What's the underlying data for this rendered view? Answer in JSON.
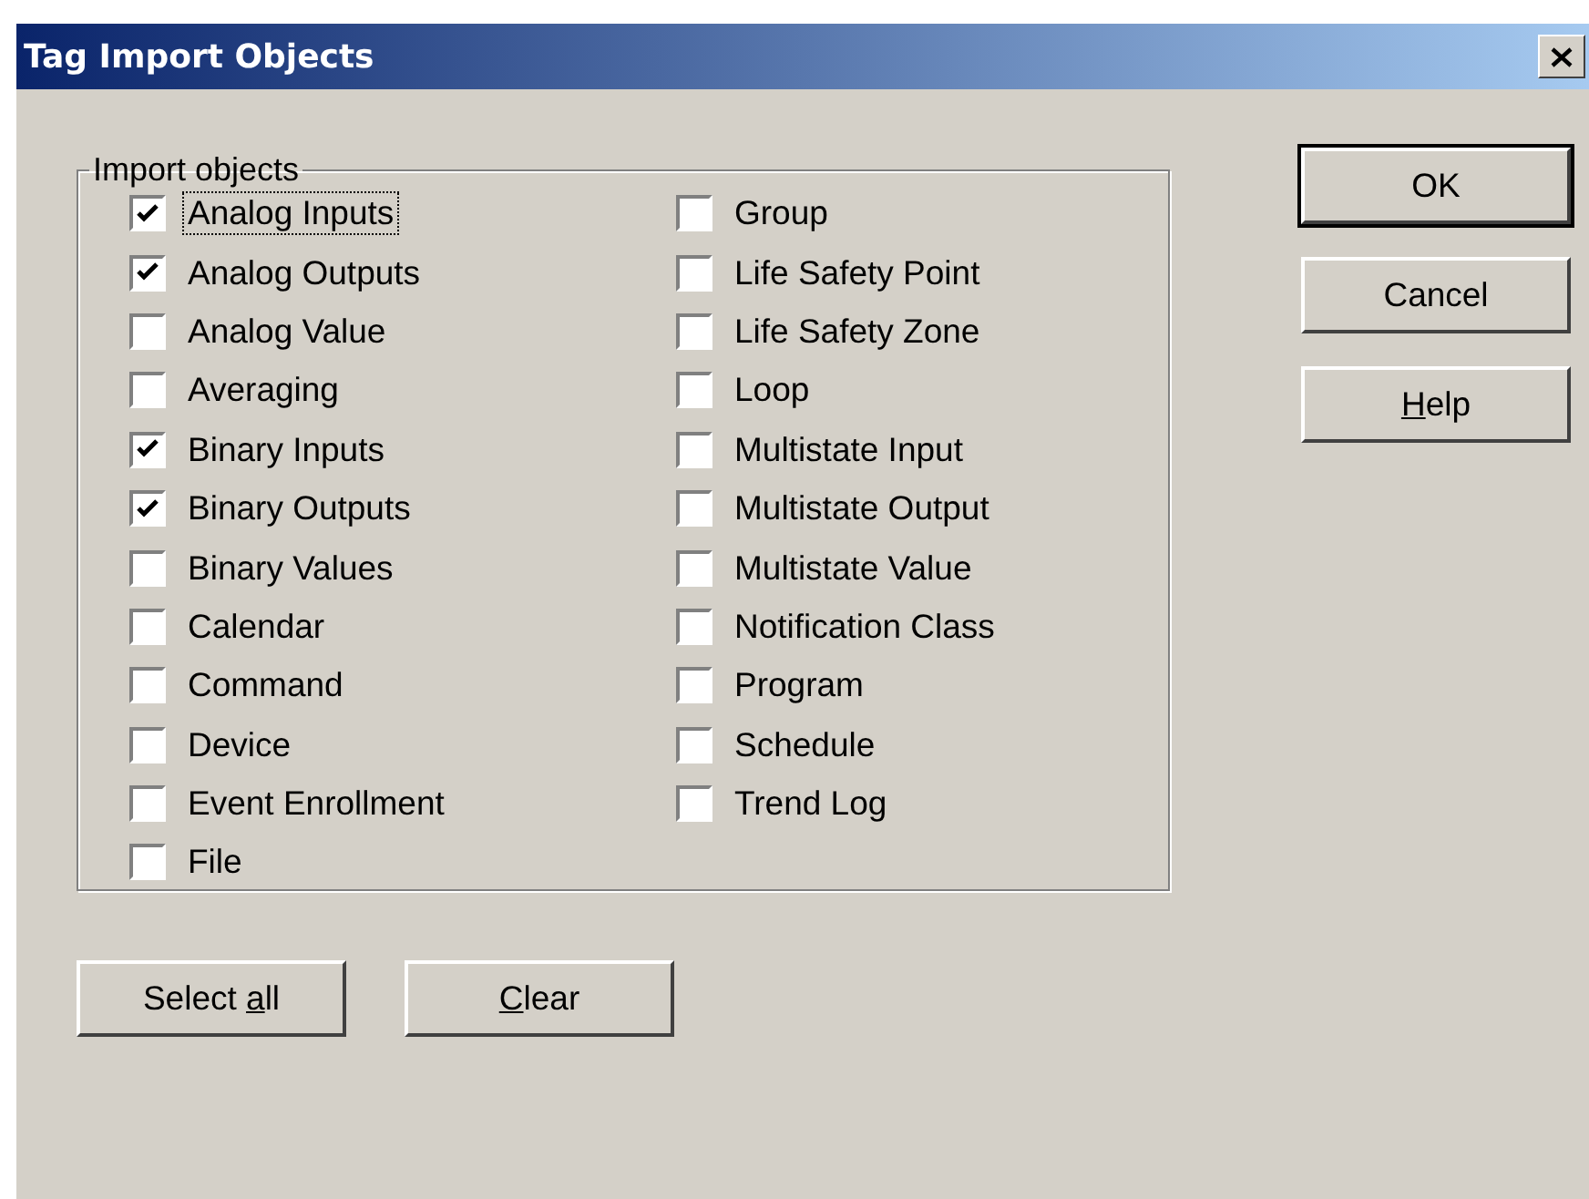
{
  "window": {
    "title": "Tag Import Objects"
  },
  "import_objects": {
    "legend": "Import objects",
    "items": [
      {
        "label": "Analog Inputs",
        "checked": true,
        "focused": true
      },
      {
        "label": "Analog Outputs",
        "checked": true,
        "focused": false
      },
      {
        "label": "Analog Value",
        "checked": false,
        "focused": false
      },
      {
        "label": "Averaging",
        "checked": false,
        "focused": false
      },
      {
        "label": "Binary Inputs",
        "checked": true,
        "focused": false
      },
      {
        "label": "Binary Outputs",
        "checked": true,
        "focused": false
      },
      {
        "label": "Binary Values",
        "checked": false,
        "focused": false
      },
      {
        "label": "Calendar",
        "checked": false,
        "focused": false
      },
      {
        "label": "Command",
        "checked": false,
        "focused": false
      },
      {
        "label": "Device",
        "checked": false,
        "focused": false
      },
      {
        "label": "Event Enrollment",
        "checked": false,
        "focused": false
      },
      {
        "label": "File",
        "checked": false,
        "focused": false
      },
      {
        "label": "Group",
        "checked": false,
        "focused": false
      },
      {
        "label": "Life Safety Point",
        "checked": false,
        "focused": false
      },
      {
        "label": "Life Safety Zone",
        "checked": false,
        "focused": false
      },
      {
        "label": "Loop",
        "checked": false,
        "focused": false
      },
      {
        "label": "Multistate Input",
        "checked": false,
        "focused": false
      },
      {
        "label": "Multistate Output",
        "checked": false,
        "focused": false
      },
      {
        "label": "Multistate Value",
        "checked": false,
        "focused": false
      },
      {
        "label": "Notification Class",
        "checked": false,
        "focused": false
      },
      {
        "label": "Program",
        "checked": false,
        "focused": false
      },
      {
        "label": "Schedule",
        "checked": false,
        "focused": false
      },
      {
        "label": "Trend Log",
        "checked": false,
        "focused": false
      }
    ]
  },
  "side_buttons": [
    {
      "label": {
        "text": "OK"
      },
      "default": true
    },
    {
      "label": {
        "text": "Cancel"
      },
      "default": false
    },
    {
      "label": {
        "underlined": "H",
        "text": "elp"
      },
      "default": false
    }
  ],
  "bottom_buttons": [
    {
      "label": {
        "text": "Select ",
        "underlined": "a",
        "after": "ll"
      }
    },
    {
      "label": {
        "underlined": "C",
        "text": "lear"
      }
    }
  ]
}
